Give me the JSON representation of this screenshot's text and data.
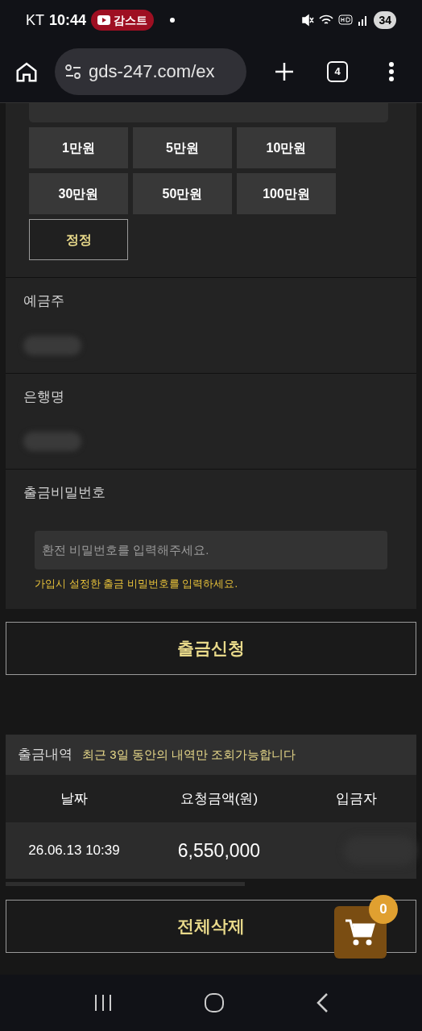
{
  "status_bar": {
    "carrier": "KT",
    "time": "10:44",
    "live_badge": "감스트",
    "battery": "34"
  },
  "browser": {
    "url": "gds-247.com/ex",
    "tab_count": "4"
  },
  "amount_buttons": [
    {
      "label": "1만원",
      "kind": "amount"
    },
    {
      "label": "5만원",
      "kind": "amount"
    },
    {
      "label": "10만원",
      "kind": "amount"
    },
    {
      "label": "30만원",
      "kind": "amount"
    },
    {
      "label": "50만원",
      "kind": "amount"
    },
    {
      "label": "100만원",
      "kind": "amount"
    },
    {
      "label": "정정",
      "kind": "reset"
    }
  ],
  "fields": [
    {
      "label": "예금주",
      "kind": "hidden"
    },
    {
      "label": "은행명",
      "kind": "hidden"
    },
    {
      "label": "출금비밀번호",
      "kind": "password",
      "placeholder": "환전 비밀번호를 입력해주세요.",
      "hint": "가입시 설정한 출금 비밀번호를 입력하세요."
    }
  ],
  "submit_button": "출금신청",
  "history": {
    "title": "출금내역",
    "notice": "최근 3일 동안의 내역만 조회가능합니다",
    "columns": [
      "날짜",
      "요청금액(원)",
      "입금자"
    ],
    "rows": [
      {
        "date": "26.06.13 10:39",
        "amount": "6,550,000"
      }
    ]
  },
  "delete_all_button": "전체삭제",
  "cart": {
    "count": "0"
  }
}
